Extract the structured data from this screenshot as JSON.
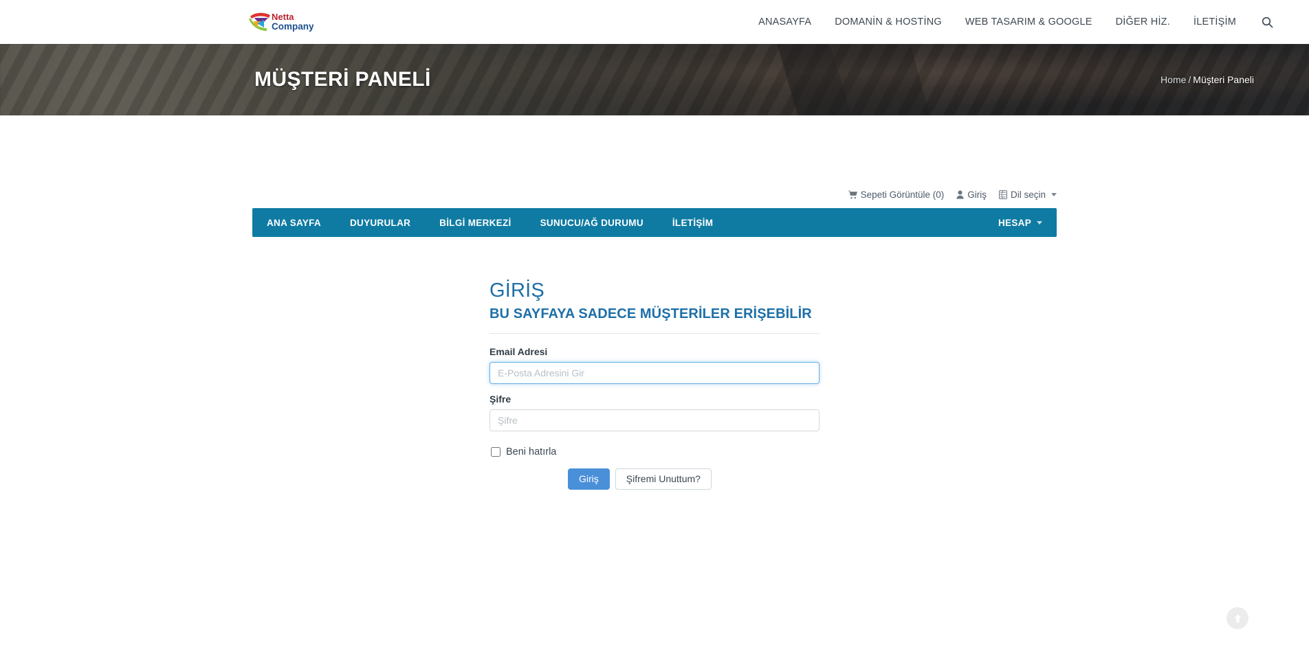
{
  "header": {
    "brand": {
      "line1": "Netta",
      "line2": "Company",
      "alt": "Netta Company"
    },
    "nav": [
      {
        "label": "ANASAYFA",
        "name": "nav-anasayfa"
      },
      {
        "label": "DOMANİN & HOSTİNG",
        "name": "nav-domain-hosting"
      },
      {
        "label": "WEB TASARIM & GOOGLE",
        "name": "nav-web-tasarim-google"
      },
      {
        "label": "DİĞER HİZ.",
        "name": "nav-diger-hiz"
      },
      {
        "label": "İLETİŞİM",
        "name": "nav-iletisim"
      }
    ],
    "search_icon": "search-icon"
  },
  "hero": {
    "title": "MÜŞTERİ PANELİ",
    "breadcrumb": {
      "home": "Home",
      "separator": "/",
      "current": "Müşteri Paneli"
    }
  },
  "client_topbar": {
    "cart": {
      "label": "Sepeti Görüntüle (0)",
      "icon": "cart-icon"
    },
    "login": {
      "label": "Giriş",
      "icon": "user-icon"
    },
    "language": {
      "label": "Dil seçin",
      "icon": "globe-icon",
      "caret": "chevron-down-icon"
    }
  },
  "client_nav": {
    "items": [
      {
        "label": "ANA SAYFA",
        "name": "client-nav-ana-sayfa"
      },
      {
        "label": "DUYURULAR",
        "name": "client-nav-duyurular"
      },
      {
        "label": "BİLGİ MERKEZİ",
        "name": "client-nav-bilgi-merkezi"
      },
      {
        "label": "SUNUCU/AĞ DURUMU",
        "name": "client-nav-sunucu-ag-durumu"
      },
      {
        "label": "İLETİŞİM",
        "name": "client-nav-iletisim"
      }
    ],
    "account": {
      "label": "HESAP",
      "caret": "chevron-down-icon"
    }
  },
  "login": {
    "title": "GİRİŞ",
    "subtitle": "BU SAYFAYA SADECE MÜŞTERİLER ERİŞEBİLİR",
    "email": {
      "label": "Email Adresi",
      "placeholder": "E-Posta Adresini Gir",
      "value": ""
    },
    "password": {
      "label": "Şifre",
      "placeholder": "Şifre",
      "value": ""
    },
    "remember": {
      "label": "Beni hatırla",
      "checked": false
    },
    "submit_label": "Giriş",
    "forgot_label": "Şifremi Unuttum?"
  },
  "scroll_top": {
    "icon": "arrow-up-icon"
  },
  "colors": {
    "client_nav_bg": "#0f7ba3",
    "heading": "#1d6fa8",
    "primary_button": "#4a90d9",
    "focus_border": "#66afe9"
  }
}
